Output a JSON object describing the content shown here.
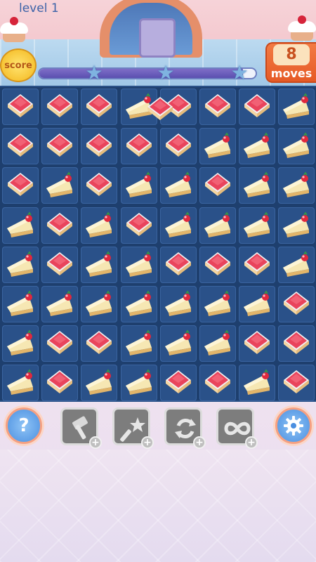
{
  "header": {
    "level_label": "level 1",
    "score_label": "score",
    "moves_value": "8",
    "moves_label": "moves",
    "progress_fraction": 0.94,
    "stars": 3
  },
  "board": {
    "rows": 8,
    "cols": 8,
    "legend": {
      "C": "red-jelly-cake",
      "P": "cheesecake-slice"
    },
    "grid": [
      "CCCPCCCP",
      "CCCCCPPP",
      "CPCPPCPP",
      "PCPCPPPP",
      "PCPPCCCP",
      "PPPPPPPC",
      "PCCPPPCC",
      "PCPPCCPC"
    ],
    "swap_animation": {
      "piece": "red-jelly-cake",
      "row": 0,
      "col": 3
    }
  },
  "toolbar": {
    "help_label": "?",
    "tools": [
      {
        "name": "hammer-booster",
        "icon": "hammer-icon"
      },
      {
        "name": "magic-wand-booster",
        "icon": "wand-icon"
      },
      {
        "name": "shuffle-booster",
        "icon": "shuffle-icon"
      },
      {
        "name": "infinite-moves-booster",
        "icon": "infinity-icon"
      }
    ],
    "add_label": "+"
  },
  "colors": {
    "board_bg": "#1e3f6e",
    "cell_bg": "#2a5189",
    "moves_orange": "#e65a26",
    "progress_purple": "#5b4fb0"
  }
}
